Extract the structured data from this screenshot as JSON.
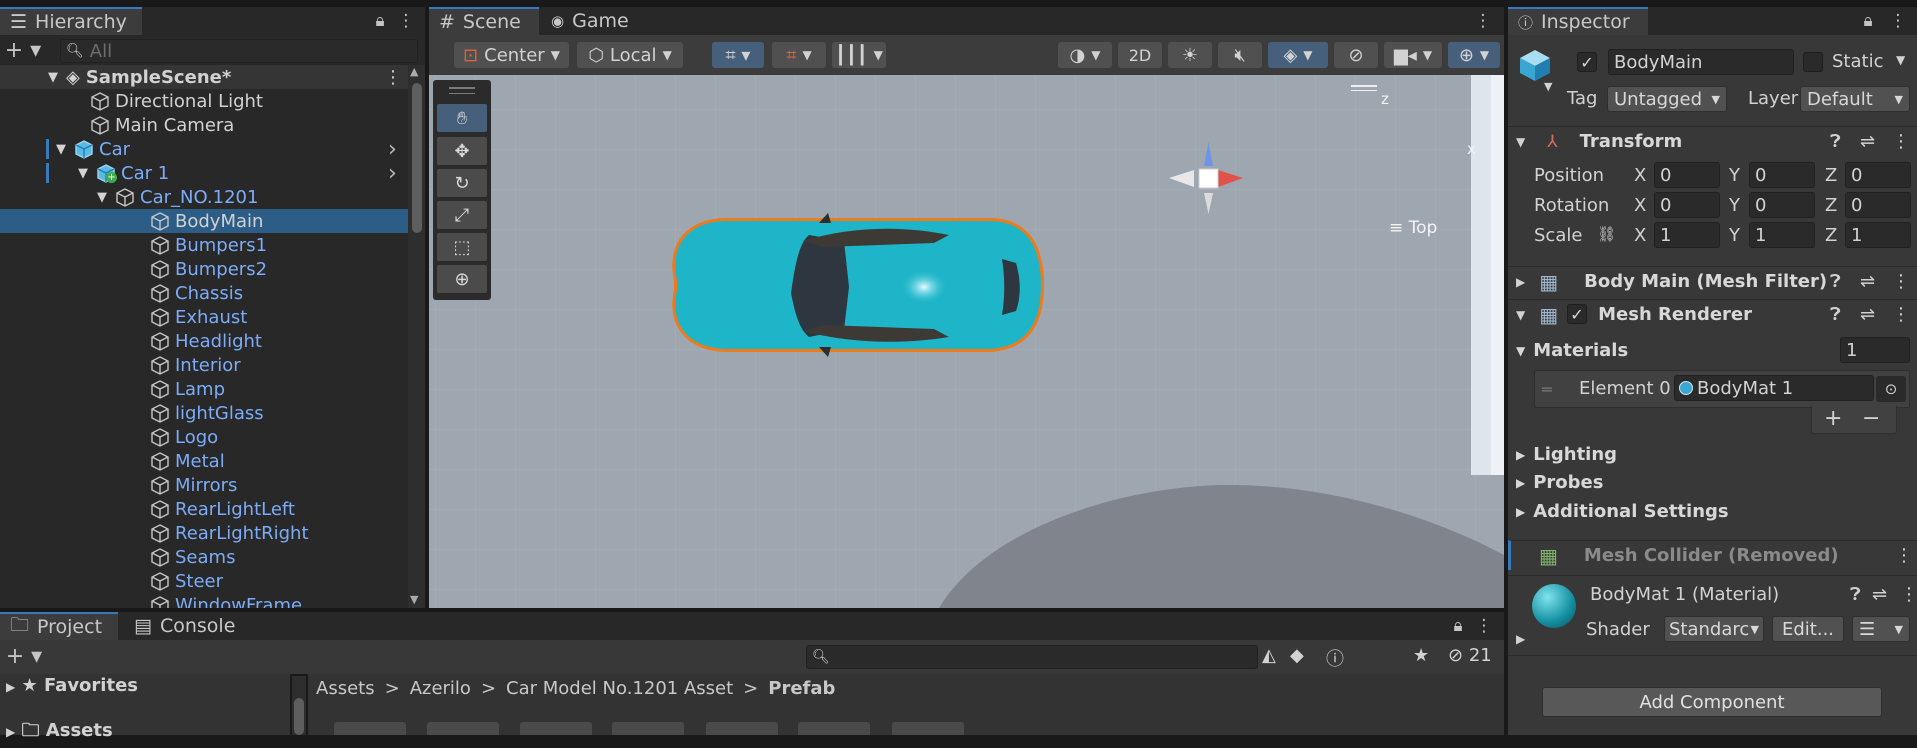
{
  "hierarchy": {
    "tab": "Hierarchy",
    "search_placeholder": "All",
    "scene": "SampleScene*",
    "items": [
      {
        "label": "Directional Light"
      },
      {
        "label": "Main Camera"
      },
      {
        "label": "Car"
      },
      {
        "label": "Car 1"
      },
      {
        "label": "Car_NO.1201"
      },
      {
        "label": "BodyMain"
      },
      {
        "label": "Bumpers1"
      },
      {
        "label": "Bumpers2"
      },
      {
        "label": "Chassis"
      },
      {
        "label": "Exhaust"
      },
      {
        "label": "Headlight"
      },
      {
        "label": "Interior"
      },
      {
        "label": "Lamp"
      },
      {
        "label": "lightGlass"
      },
      {
        "label": "Logo"
      },
      {
        "label": "Metal"
      },
      {
        "label": "Mirrors"
      },
      {
        "label": "RearLightLeft"
      },
      {
        "label": "RearLightRight"
      },
      {
        "label": "Seams"
      },
      {
        "label": "Steer"
      },
      {
        "label": "WindowFrame"
      }
    ]
  },
  "scene_view": {
    "tabs": [
      "Scene",
      "Game"
    ],
    "pivot": "Center",
    "space": "Local",
    "mode_2d": "2D",
    "gizmo_label": "Top",
    "axis_z": "z",
    "axis_x": "x"
  },
  "inspector": {
    "tab": "Inspector",
    "object_name": "BodyMain",
    "static_label": "Static",
    "tag_label": "Tag",
    "tag_value": "Untagged",
    "layer_label": "Layer",
    "layer_value": "Default",
    "transform": {
      "title": "Transform",
      "position_label": "Position",
      "rotation_label": "Rotation",
      "scale_label": "Scale",
      "position": [
        "0",
        "0",
        "0"
      ],
      "rotation": [
        "0",
        "0",
        "0"
      ],
      "scale": [
        "1",
        "1",
        "1"
      ],
      "x": "X",
      "y": "Y",
      "z": "Z"
    },
    "mesh_filter": "Body Main (Mesh Filter)",
    "mesh_renderer": "Mesh Renderer",
    "materials_label": "Materials",
    "materials_count": "1",
    "element0_label": "Element 0",
    "element0_value": "BodyMat 1",
    "lighting": "Lighting",
    "probes": "Probes",
    "additional": "Additional Settings",
    "mesh_collider": "Mesh Collider (Removed)",
    "material_title": "BodyMat 1 (Material)",
    "shader_label": "Shader",
    "shader_value": "Standarc",
    "edit_label": "Edit...",
    "add_component": "Add Component"
  },
  "project": {
    "tabs": [
      "Project",
      "Console"
    ],
    "hidden_count": "21",
    "favorites": "Favorites",
    "assets": "Assets",
    "breadcrumb": [
      "Assets",
      "Azerilo",
      "Car Model No.1201 Asset",
      "Prefab"
    ]
  },
  "colors": {
    "accent": "#3a79bb",
    "selection": "#2c5d87",
    "prefab_blue": "#7cacf8",
    "car": "#1fb5c8",
    "outline": "#f07a19"
  }
}
